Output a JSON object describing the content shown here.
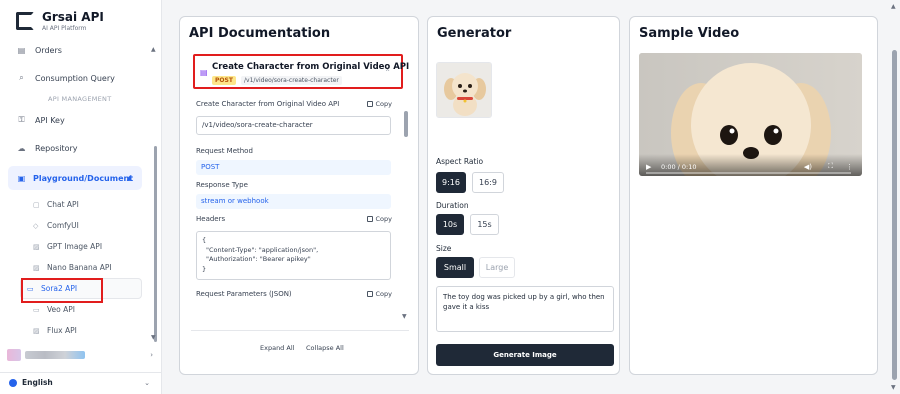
{
  "brand": {
    "name": "Grsai API",
    "subtitle": "AI API Platform"
  },
  "sidebar": {
    "items": [
      {
        "label": "Orders",
        "icon": "box-icon"
      },
      {
        "label": "Consumption Query",
        "icon": "search-icon"
      }
    ],
    "section_management": "API MANAGEMENT",
    "mgmt_items": [
      {
        "label": "API Key",
        "icon": "key-icon"
      },
      {
        "label": "Repository",
        "icon": "cloud-icon"
      }
    ],
    "parent": {
      "label": "Playground/Document",
      "icon": "folder-icon"
    },
    "sub_items": [
      {
        "label": "Chat API",
        "icon": "chat-icon"
      },
      {
        "label": "ComfyUI",
        "icon": "workflow-icon"
      },
      {
        "label": "GPT Image API",
        "icon": "image-icon"
      },
      {
        "label": "Nano Banana API",
        "icon": "image-icon"
      },
      {
        "label": "Sora2 API",
        "icon": "video-icon",
        "active": true
      },
      {
        "label": "Veo API",
        "icon": "video-icon"
      },
      {
        "label": "Flux API",
        "icon": "image-icon"
      }
    ],
    "language": "English"
  },
  "api_doc": {
    "title": "API Documentation",
    "card": {
      "title": "Create Character from Original Video API",
      "method": "POST",
      "path": "/v1/video/sora-create-character"
    },
    "fields": {
      "endpoint_label": "Create Character from Original Video API",
      "endpoint_value": "/v1/video/sora-create-character",
      "method_label": "Request Method",
      "method_value": "POST",
      "response_label": "Response Type",
      "response_value": "stream or webhook",
      "headers_label": "Headers",
      "headers_open": "{",
      "headers_line1": "\"Content-Type\": \"application/json\",",
      "headers_line2": "\"Authorization\": \"Bearer apikey\"",
      "headers_close": "}",
      "params_label": "Request Parameters (JSON)",
      "copy_label": "Copy"
    },
    "expand_all": "Expand All",
    "collapse_all": "Collapse All"
  },
  "generator": {
    "title": "Generator",
    "aspect_label": "Aspect Ratio",
    "aspect_options": [
      "9:16",
      "16:9"
    ],
    "duration_label": "Duration",
    "duration_options": [
      "10s",
      "15s"
    ],
    "size_label": "Size",
    "size_options": [
      "Small",
      "Large"
    ],
    "prompt": "The toy dog was picked up by a girl, who then gave it a kiss",
    "button": "Generate Image"
  },
  "sample": {
    "title": "Sample Video",
    "time": "0:00 / 0:10"
  },
  "colors": {
    "accent": "#2563eb",
    "primary_dark": "#1f2937",
    "highlight_red": "#e11d1d"
  }
}
